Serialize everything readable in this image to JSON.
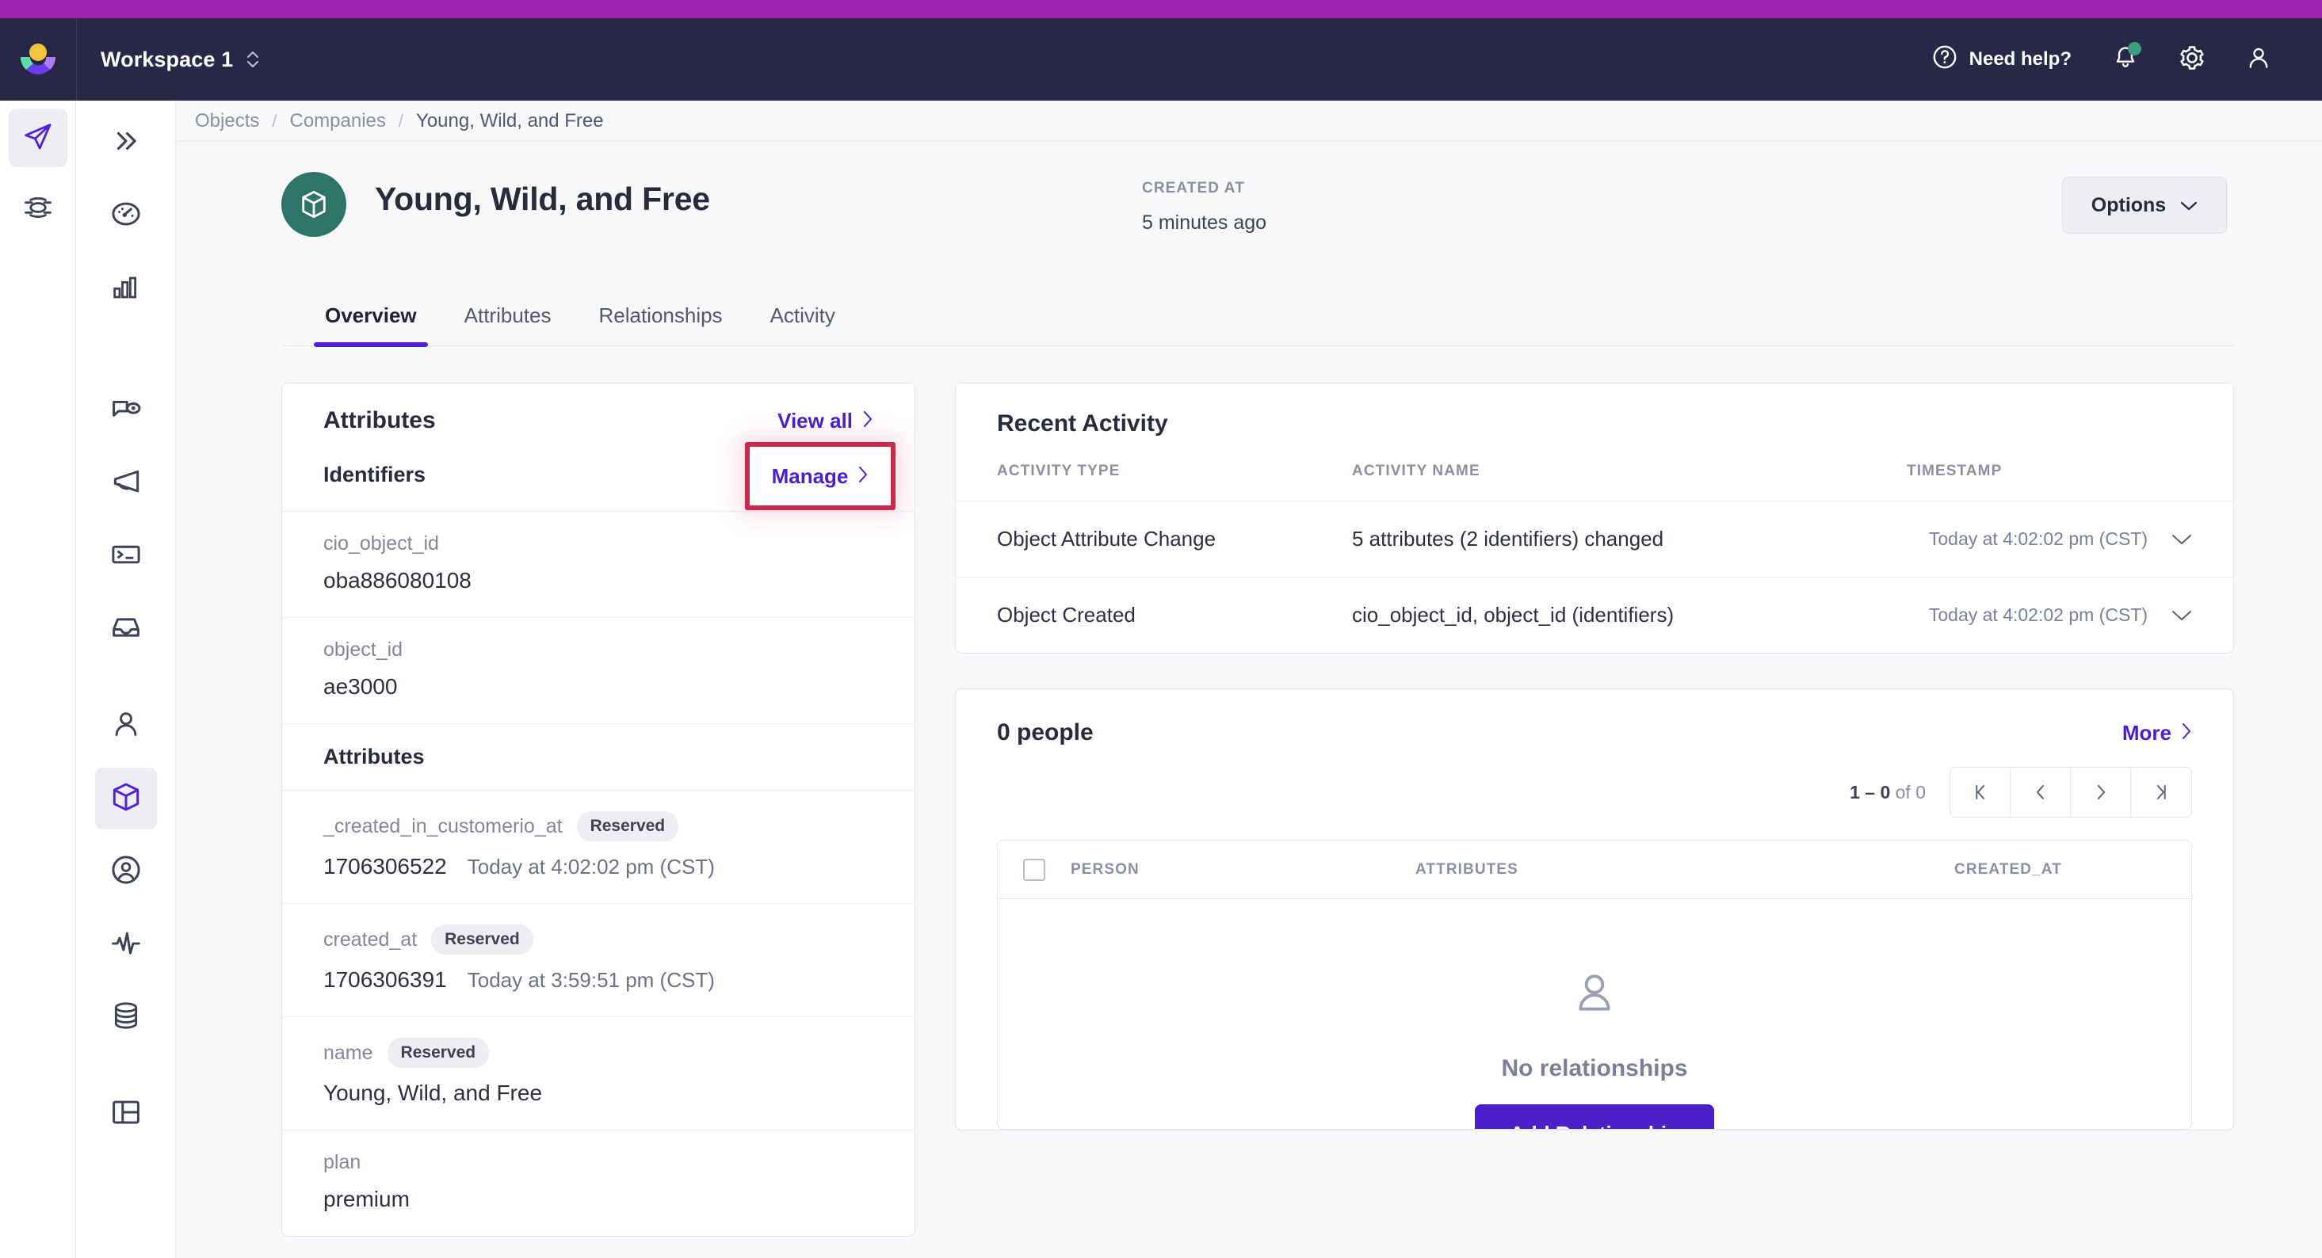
{
  "topbar": {
    "workspace": "Workspace 1",
    "need_help": "Need help?",
    "logo": "customerio-logo",
    "icons": [
      "help-circle-icon",
      "bell-icon",
      "gear-icon",
      "account-icon"
    ]
  },
  "rails": {
    "outer": [
      {
        "name": "paper-plane-icon",
        "active": true
      },
      {
        "name": "layers-icon",
        "active": false
      }
    ],
    "inner": [
      {
        "name": "collapse-chevrons-icon",
        "active": false
      },
      {
        "name": "dashboard-gauge-icon",
        "active": false
      },
      {
        "name": "bar-chart-icon",
        "active": false
      },
      {
        "name": "chat-eye-icon",
        "active": false
      },
      {
        "name": "megaphone-icon",
        "active": false
      },
      {
        "name": "terminal-icon",
        "active": false
      },
      {
        "name": "inbox-icon",
        "active": false
      },
      {
        "name": "person-icon",
        "active": false
      },
      {
        "name": "cube-icon",
        "active": true
      },
      {
        "name": "user-circle-icon",
        "active": false
      },
      {
        "name": "activity-pulse-icon",
        "active": false
      },
      {
        "name": "database-icon",
        "active": false
      },
      {
        "name": "table-icon",
        "active": false
      }
    ]
  },
  "breadcrumb": {
    "items": [
      "Objects",
      "Companies",
      "Young, Wild, and Free"
    ],
    "separator": "/"
  },
  "header": {
    "title": "Young, Wild, and Free",
    "avatar_icon": "cube-icon",
    "created_label": "CREATED AT",
    "created_value": "5 minutes ago",
    "options_label": "Options"
  },
  "tabs": [
    {
      "label": "Overview",
      "active": true
    },
    {
      "label": "Attributes",
      "active": false
    },
    {
      "label": "Relationships",
      "active": false
    },
    {
      "label": "Activity",
      "active": false
    }
  ],
  "attributes_card": {
    "title": "Attributes",
    "view_all_label": "View all",
    "identifiers_title": "Identifiers",
    "manage_label": "Manage",
    "highlight_color": "#c9294b",
    "identifiers": [
      {
        "key": "cio_object_id",
        "value": "oba886080108",
        "badge": "",
        "sub": ""
      },
      {
        "key": "object_id",
        "value": "ae3000",
        "badge": "",
        "sub": ""
      }
    ],
    "attributes_section_title": "Attributes",
    "attributes": [
      {
        "key": "_created_in_customerio_at",
        "badge": "Reserved",
        "value": "1706306522",
        "sub": "Today at 4:02:02 pm (CST)"
      },
      {
        "key": "created_at",
        "badge": "Reserved",
        "value": "1706306391",
        "sub": "Today at 3:59:51 pm (CST)"
      },
      {
        "key": "name",
        "badge": "Reserved",
        "value": "Young, Wild, and Free",
        "sub": ""
      },
      {
        "key": "plan",
        "badge": "",
        "value": "premium",
        "sub": ""
      }
    ]
  },
  "recent_activity": {
    "title": "Recent Activity",
    "columns": [
      "ACTIVITY TYPE",
      "ACTIVITY NAME",
      "TIMESTAMP"
    ],
    "rows": [
      {
        "type": "Object Attribute Change",
        "name": "5 attributes (2 identifiers) changed",
        "timestamp": "Today at 4:02:02 pm (CST)"
      },
      {
        "type": "Object Created",
        "name": "cio_object_id, object_id (identifiers)",
        "timestamp": "Today at 4:02:02 pm (CST)"
      }
    ]
  },
  "people_card": {
    "title": "0 people",
    "more_label": "More",
    "pager_range": "1 – 0",
    "pager_of": "of 0",
    "pager_buttons": [
      "first-page-icon",
      "prev-page-icon",
      "next-page-icon",
      "last-page-icon"
    ],
    "columns": [
      "PERSON",
      "ATTRIBUTES",
      "CREATED_AT"
    ],
    "empty_icon": "person-icon",
    "empty_text": "No relationships",
    "add_button": "Add Relationship"
  },
  "colors": {
    "accent_purple": "#9c24b0",
    "brand_purple": "#4b1fc9",
    "tab_underline": "#5521d8",
    "navy": "#272747",
    "avatar_teal": "#2f7468",
    "highlight_red": "#c9294b",
    "notification_green": "#3f9d7f"
  }
}
